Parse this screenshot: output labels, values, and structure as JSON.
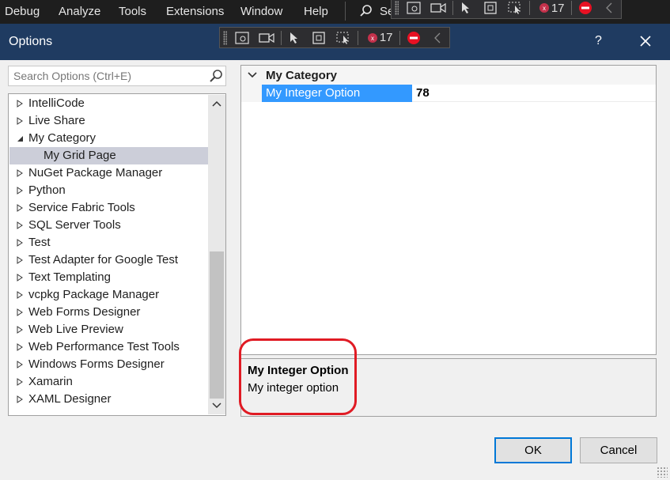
{
  "menubar": {
    "items": [
      "Debug",
      "Analyze",
      "Tools",
      "Extensions",
      "Window",
      "Help"
    ],
    "search_text": "Se"
  },
  "debug_toolbar": {
    "breakpoint_count": "17"
  },
  "dialog": {
    "title": "Options",
    "help_label": "?"
  },
  "search": {
    "placeholder": "Search Options (Ctrl+E)"
  },
  "tree": {
    "items": [
      {
        "label": "IntelliCode",
        "state": "collapsed"
      },
      {
        "label": "Live Share",
        "state": "collapsed"
      },
      {
        "label": "My Category",
        "state": "expanded"
      },
      {
        "label": "My Grid Page",
        "state": "child-selected"
      },
      {
        "label": "NuGet Package Manager",
        "state": "collapsed"
      },
      {
        "label": "Python",
        "state": "collapsed"
      },
      {
        "label": "Service Fabric Tools",
        "state": "collapsed"
      },
      {
        "label": "SQL Server Tools",
        "state": "collapsed"
      },
      {
        "label": "Test",
        "state": "collapsed"
      },
      {
        "label": "Test Adapter for Google Test",
        "state": "collapsed"
      },
      {
        "label": "Text Templating",
        "state": "collapsed"
      },
      {
        "label": "vcpkg Package Manager",
        "state": "collapsed"
      },
      {
        "label": "Web Forms Designer",
        "state": "collapsed"
      },
      {
        "label": "Web Live Preview",
        "state": "collapsed"
      },
      {
        "label": "Web Performance Test Tools",
        "state": "collapsed"
      },
      {
        "label": "Windows Forms Designer",
        "state": "collapsed"
      },
      {
        "label": "Xamarin",
        "state": "collapsed"
      },
      {
        "label": "XAML Designer",
        "state": "collapsed"
      }
    ]
  },
  "property_grid": {
    "category": "My Category",
    "property_name": "My Integer Option",
    "property_value": "78"
  },
  "description": {
    "title": "My Integer Option",
    "text": "My integer option"
  },
  "buttons": {
    "ok": "OK",
    "cancel": "Cancel"
  },
  "colors": {
    "titlebar": "#1f3b61",
    "selection": "#3399ff",
    "tree_selection": "#ccced9",
    "highlight": "#e01b24"
  }
}
